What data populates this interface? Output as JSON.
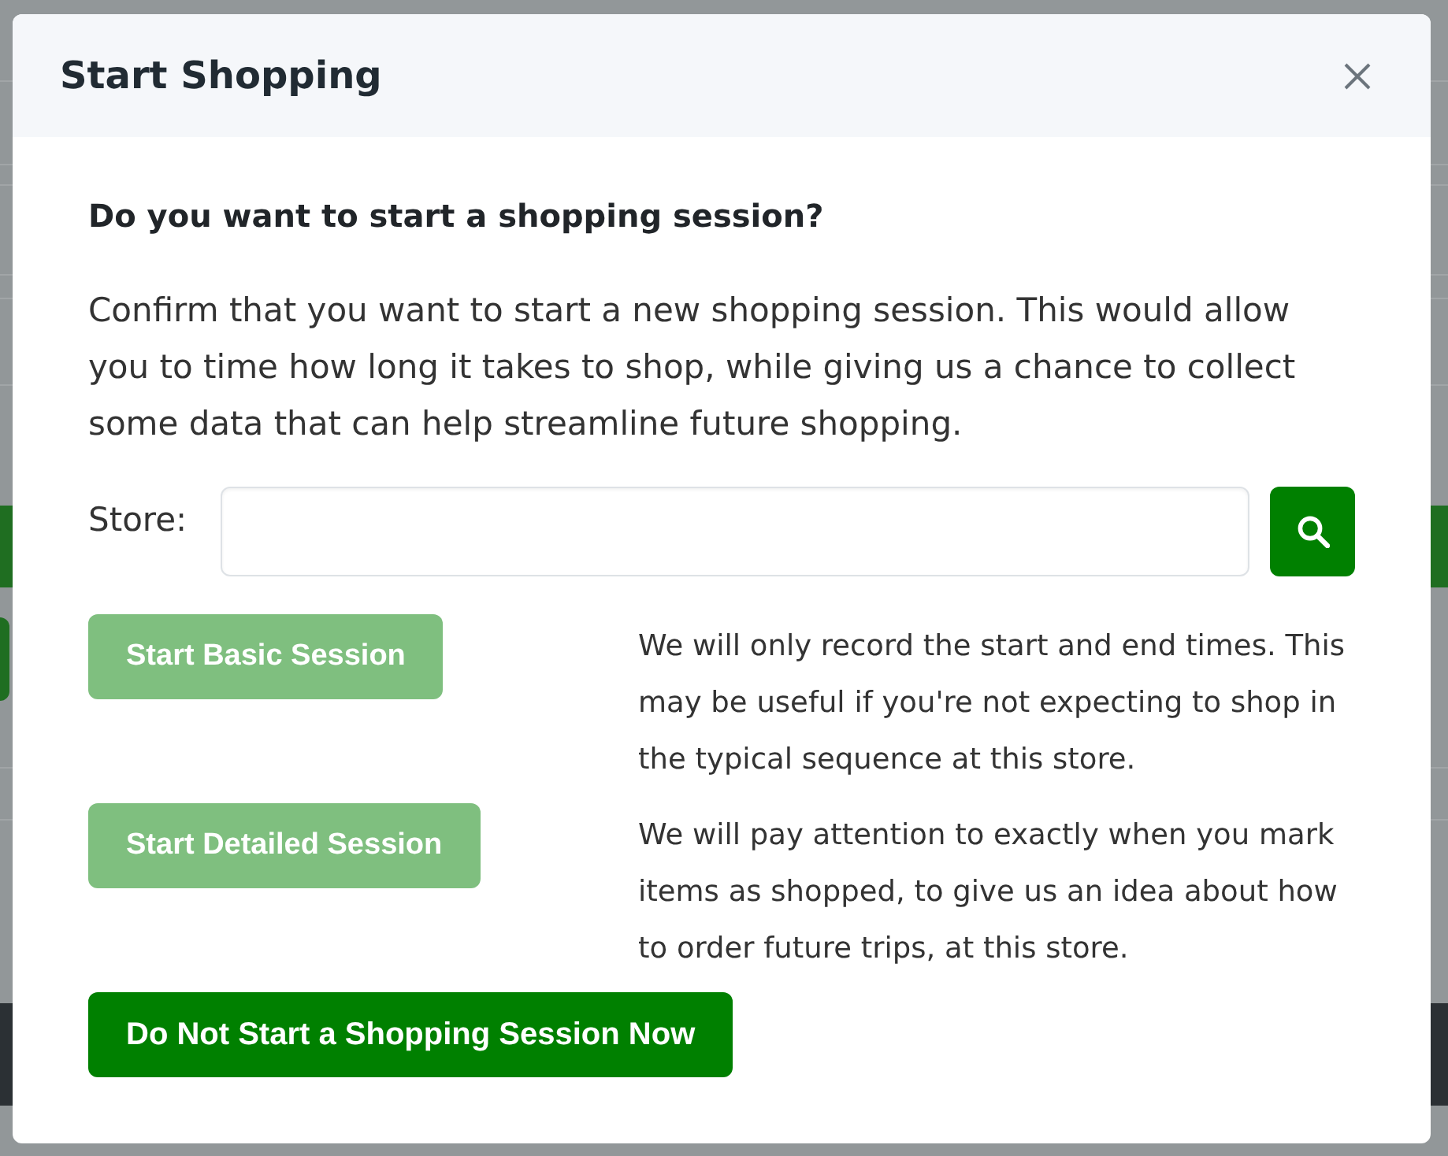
{
  "dialog": {
    "title": "Start Shopping"
  },
  "prompt": {
    "question": "Do you want to start a shopping session?",
    "text": "Confirm that you want to start a new shopping session. This would allow you to time how long it takes to shop, while giving us a chance to collect some data that can help streamline future shopping."
  },
  "store_field": {
    "label": "Store:"
  },
  "session_options": [
    {
      "label": "Start Basic Session",
      "disabled": true,
      "description": "We will only record the start and end times. This may be useful if you're not expecting to shop in the typical sequence at this store."
    },
    {
      "label": "Start Detailed Session",
      "disabled": true,
      "description": "We will pay attention to exactly when you mark items as shopped, to give us an idea about how to order future trips, at this store."
    }
  ],
  "decline_button": {
    "label": "Do Not Start a Shopping Session Now",
    "disabled": false
  }
}
